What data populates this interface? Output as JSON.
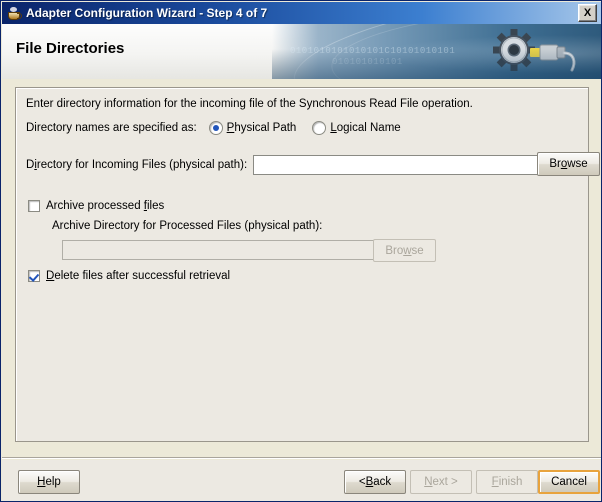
{
  "window": {
    "title": "Adapter Configuration Wizard - Step 4 of 7",
    "app_icon": "java-coffee-cup-icon",
    "close_label": "X"
  },
  "banner": {
    "heading": "File Directories",
    "binary_line_1": "0101010101010101C10101010101",
    "binary_line_2": "010101010101",
    "art_icon": "gear-plug-icon"
  },
  "content": {
    "intro_text": "Enter directory information for the incoming file of the Synchronous Read File operation.",
    "specified_as_label": "Directory names are specified as:",
    "radios": [
      {
        "id": "physical-path",
        "label_pre": "",
        "mnemonic": "P",
        "label_post": "hysical Path",
        "checked": true
      },
      {
        "id": "logical-name",
        "label_pre": "",
        "mnemonic": "L",
        "label_post": "ogical Name",
        "checked": false
      }
    ],
    "incoming": {
      "label_pre": "D",
      "label_mn": "i",
      "label_post": "rectory for Incoming Files (physical path):",
      "value": "",
      "placeholder": "",
      "browse_pre": "Br",
      "browse_mn": "o",
      "browse_post": "wse",
      "enabled": true
    },
    "archive_checkbox": {
      "label_pre": "Archive processed ",
      "label_mn": "f",
      "label_post": "iles",
      "checked": false
    },
    "archive_field": {
      "label": "Archive Directory for Processed Files (physical path):",
      "value": "",
      "placeholder": "",
      "browse_pre": "Bro",
      "browse_mn": "w",
      "browse_post": "se",
      "enabled": false
    },
    "delete_checkbox": {
      "label_pre": "",
      "label_mn": "D",
      "label_post": "elete files after successful retrieval",
      "checked": true
    }
  },
  "footer": {
    "help": {
      "pre": "",
      "mn": "H",
      "post": "elp",
      "enabled": true
    },
    "back": {
      "pre": "< ",
      "mn": "B",
      "post": "ack",
      "enabled": true
    },
    "next": {
      "pre": "",
      "mn": "N",
      "post": "ext >",
      "enabled": false
    },
    "finish": {
      "pre": "",
      "mn": "F",
      "post": "inish",
      "enabled": false
    },
    "cancel": {
      "pre": "",
      "mn": "",
      "post": "Cancel",
      "enabled": true,
      "focused": true
    }
  },
  "colors": {
    "title_bar_start": "#0a246a",
    "title_bar_end": "#a8c8ea",
    "panel_bg": "#ece9e2",
    "accent_check": "#2255bb",
    "focus_border": "#e8a33d"
  }
}
